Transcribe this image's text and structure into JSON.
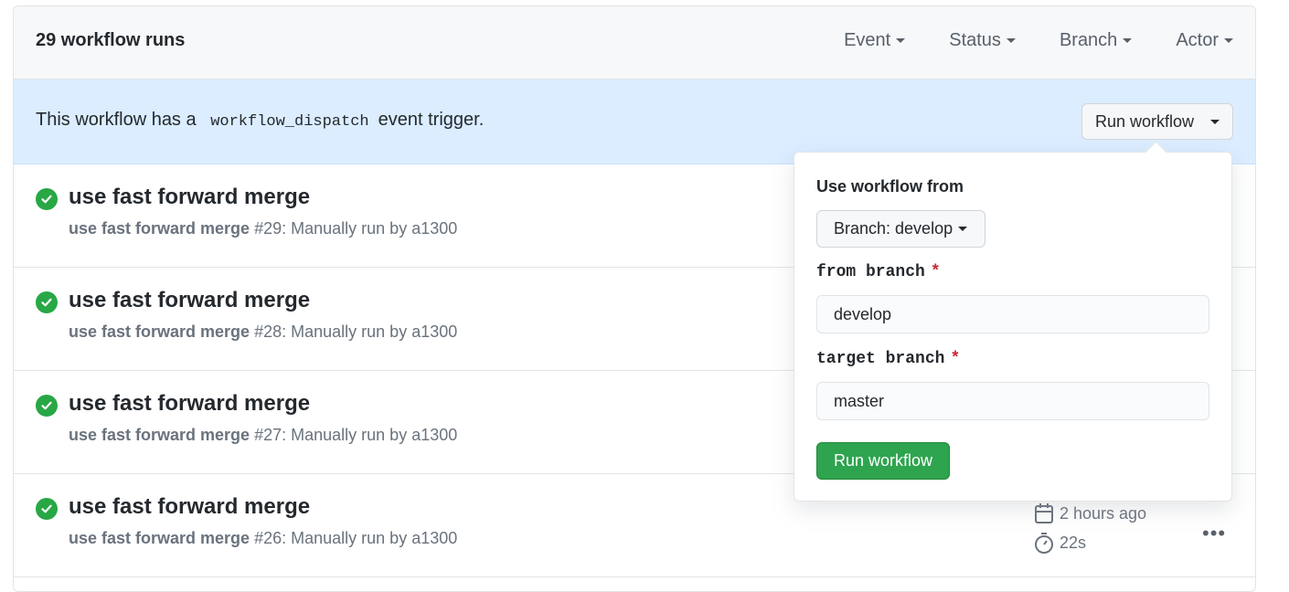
{
  "header": {
    "title": "29 workflow runs",
    "filters": [
      "Event",
      "Status",
      "Branch",
      "Actor"
    ]
  },
  "banner": {
    "text_before": "This workflow has a",
    "code": "workflow_dispatch",
    "text_after": "event trigger.",
    "run_button": "Run workflow"
  },
  "runs": [
    {
      "title": "use fast forward merge",
      "workflow": "use fast forward merge",
      "number": "#29",
      "detail": ": Manually run by a1300"
    },
    {
      "title": "use fast forward merge",
      "workflow": "use fast forward merge",
      "number": "#28",
      "detail": ": Manually run by a1300"
    },
    {
      "title": "use fast forward merge",
      "workflow": "use fast forward merge",
      "number": "#27",
      "detail": ": Manually run by a1300"
    },
    {
      "title": "use fast forward merge",
      "workflow": "use fast forward merge",
      "number": "#26",
      "detail": ": Manually run by a1300",
      "time": "2 hours ago",
      "duration": "22s"
    }
  ],
  "popover": {
    "title": "Use workflow from",
    "branch_button": "Branch: develop",
    "inputs": [
      {
        "label": "from branch",
        "required": "*",
        "value": "develop"
      },
      {
        "label": "target branch",
        "required": "*",
        "value": "master"
      }
    ],
    "submit": "Run workflow"
  },
  "colors": {
    "success": "#28a745",
    "banner_bg": "#dbedff",
    "primary_button": "#2ea44f",
    "required": "#cb2431"
  }
}
